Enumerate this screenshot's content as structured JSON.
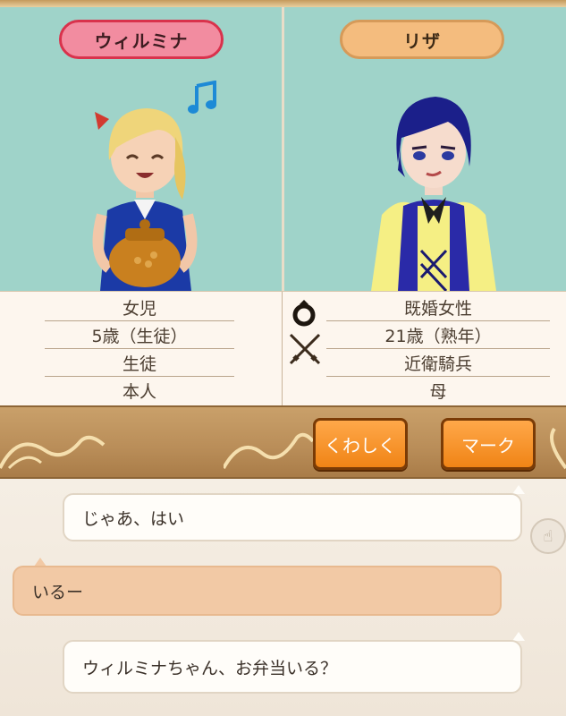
{
  "left_character": {
    "name": "ウィルミナ",
    "info": [
      "女児",
      "5歳（生徒）",
      "生徒",
      "本人"
    ]
  },
  "right_character": {
    "name": "リザ",
    "info": [
      "既婚女性",
      "21歳（熟年）",
      "近衛騎兵",
      "母"
    ]
  },
  "symbols": {
    "ring": "ring-icon",
    "swords": "crossed-swords-icon"
  },
  "buttons": {
    "detail_label": "くわしく",
    "mark_label": "マーク"
  },
  "chat": [
    {
      "text": "じゃあ、はい",
      "style": "white"
    },
    {
      "text": "いるー",
      "style": "peach"
    },
    {
      "text": "ウィルミナちゃん、お弁当いる？",
      "style": "white"
    }
  ],
  "colors": {
    "accent_orange": "#f08416",
    "left_tag": "#f28ca0",
    "right_tag": "#f4bc7e",
    "bar_brown": "#b98d58"
  }
}
